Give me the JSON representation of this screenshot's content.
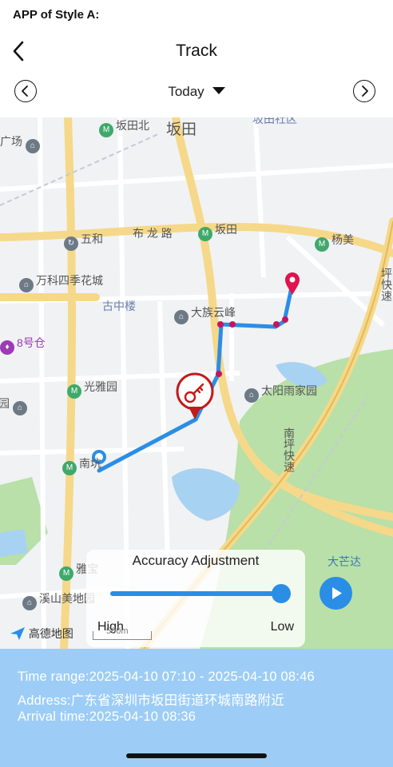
{
  "caption": "APP of Style A:",
  "header": {
    "title": "Track"
  },
  "date_nav": {
    "selected": "Today"
  },
  "map": {
    "labels": {
      "futian_north": "坂田北",
      "futian_big": "坂田",
      "futian_community": "坂田社区",
      "guangchang": "广场",
      "wuhe": "五和",
      "bulong_road": "布 龙 路",
      "bantian": "坂田",
      "yangmei": "杨美",
      "wanke": "万科四季花城",
      "guzhonglou": "古中楼",
      "dazu": "大族云峰",
      "cang8": "8号仓",
      "guangya": "光雅园",
      "taiyang": "太阳雨家园",
      "huayuan": "花园",
      "nankeng": "南坑",
      "yabao": "雅宝",
      "xishan": "溪山美地园",
      "damangda": "大芒达",
      "nanping_fast1": "南坪快速",
      "ping_fast2": "坪快速"
    },
    "logo_text": "高德地图",
    "scale_text": "500m"
  },
  "accuracy": {
    "title": "Accuracy Adjustment",
    "high_label": "High",
    "low_label": "Low",
    "level": 1.0
  },
  "info": {
    "time_range": "Time range:2025-04-10 07:10 - 2025-04-10 08:46",
    "address": "Address:广东省深圳市坂田街道环城南路附近",
    "arrival": "Arrival time:2025-04-10 08:36"
  },
  "colors": {
    "route": "#2a8ee6",
    "pin": "#e0134f",
    "info_bg": "#9dcdf6",
    "park": "#b8e0a8",
    "water": "#a8d2f2"
  }
}
